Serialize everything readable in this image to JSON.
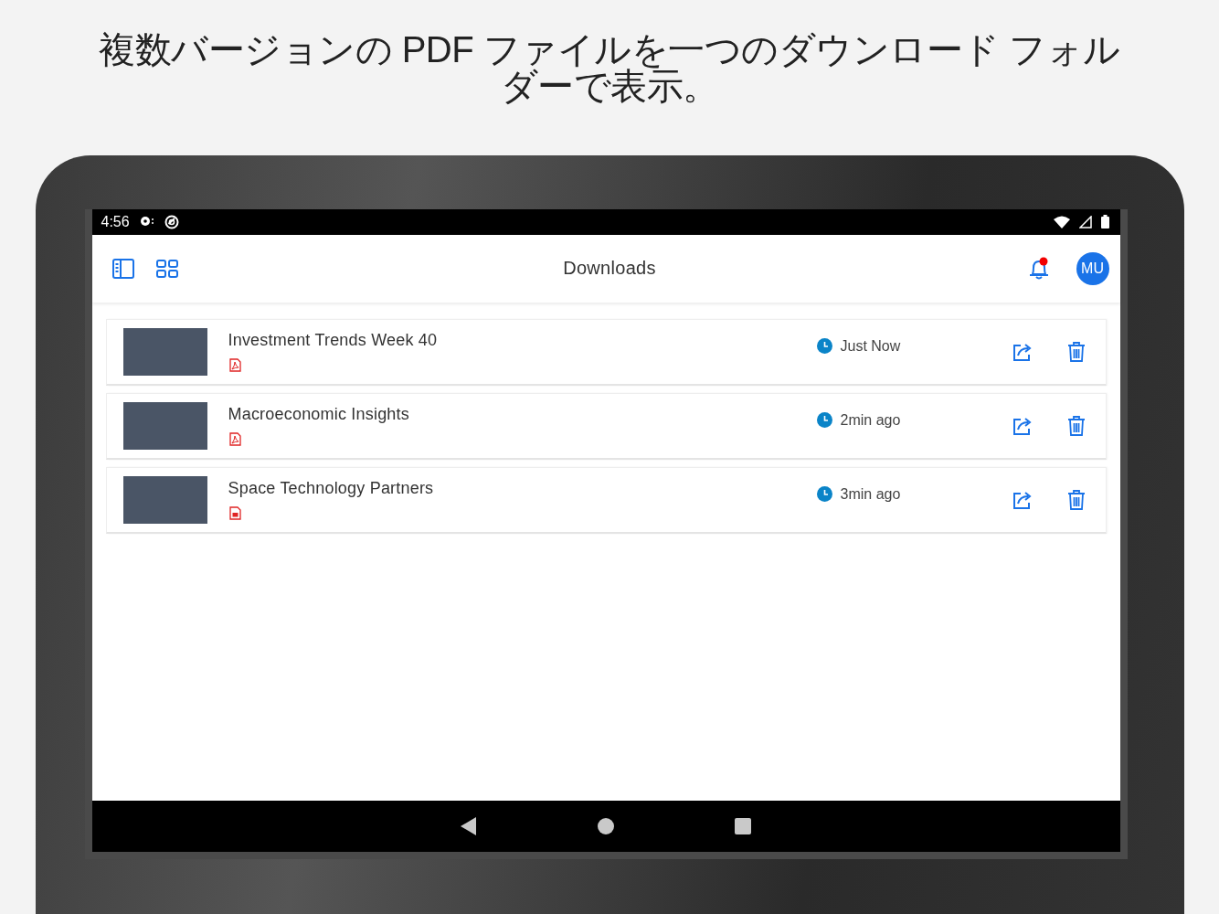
{
  "caption": "複数バージョンの PDF ファイルを一つのダウンロード フォルダーで表示。",
  "status_bar": {
    "time": "4:56"
  },
  "app_bar": {
    "title": "Downloads",
    "has_unread": true,
    "avatar_initials": "MU"
  },
  "downloads": [
    {
      "title": "Investment Trends Week 40",
      "kind": "pdf",
      "time": "Just Now"
    },
    {
      "title": "Macroeconomic Insights",
      "kind": "pdf",
      "time": "2min ago"
    },
    {
      "title": "Space Technology Partners",
      "kind": "doc",
      "time": "3min ago"
    }
  ]
}
